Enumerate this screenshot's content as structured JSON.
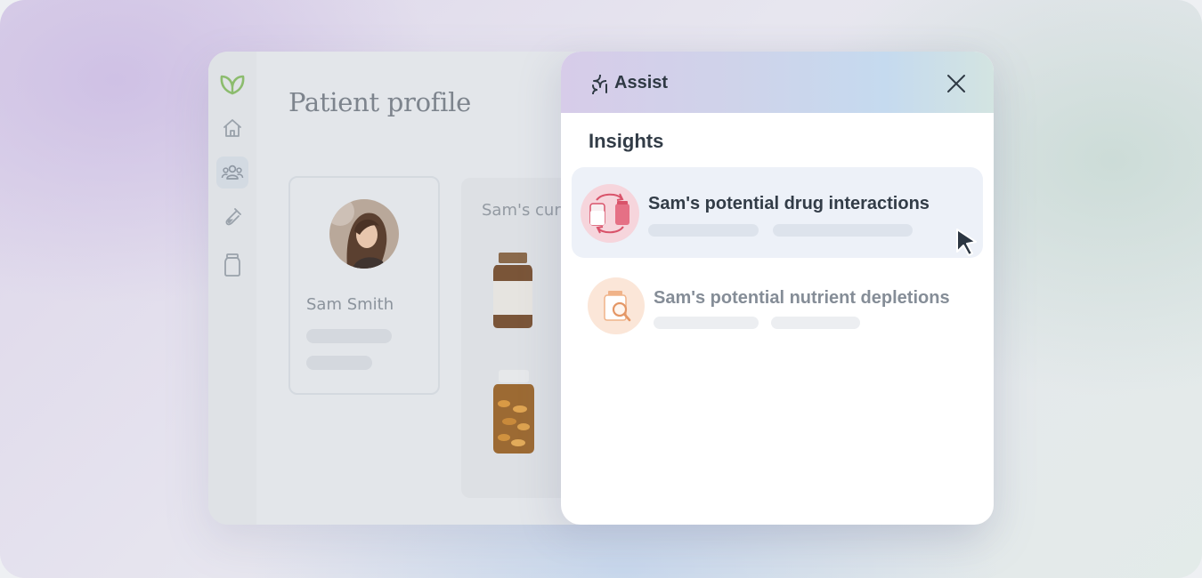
{
  "app": {
    "page_title": "Patient profile",
    "sidebar": {
      "items": [
        {
          "icon": "home-icon"
        },
        {
          "icon": "users-icon",
          "active": true
        },
        {
          "icon": "test-tube-icon"
        },
        {
          "icon": "medicine-jar-icon"
        }
      ]
    },
    "patient": {
      "name": "Sam Smith"
    },
    "medications": {
      "title": "Sam's cur"
    }
  },
  "assist": {
    "title": "Assist",
    "section_title": "Insights",
    "items": [
      {
        "label": "Sam's potential drug interactions",
        "icon": "drug-interactions-icon",
        "selected": true
      },
      {
        "label": "Sam's potential nutrient depletions",
        "icon": "nutrient-depletion-icon",
        "selected": false
      }
    ]
  },
  "colors": {
    "brand_green": "#8cbc6e",
    "text_dark": "#323c47",
    "selected_row": "#edf1f8",
    "interaction_badge": "#f6d5dc",
    "depletion_badge": "#fbe6d8"
  }
}
